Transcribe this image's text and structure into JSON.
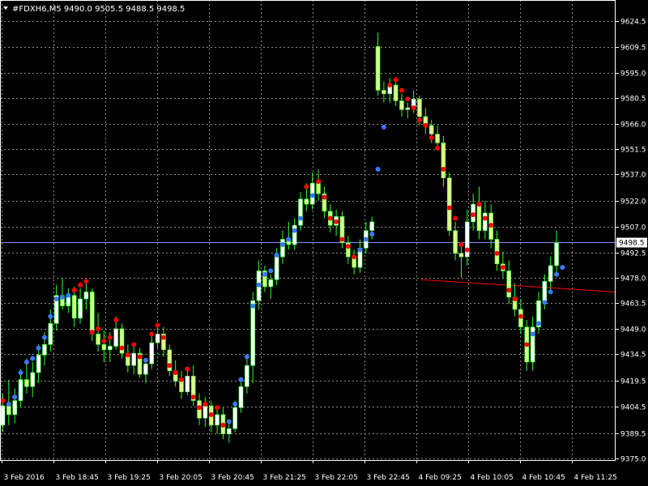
{
  "header": {
    "symbol_line": "#FDXH6,M5  9490.0 9505.5 9488.5 9498.5",
    "menu_icon": "triangle-down-icon"
  },
  "colors": {
    "background": "#000000",
    "grid": "#8c8c8c",
    "frame": "#ffffff",
    "axis_text": "#ffffff",
    "candle_wick": "#2aff2a",
    "bull_body": "#ffffff",
    "bear_body": "#d8ff8a",
    "dot_red": "#ff0000",
    "dot_blue": "#3c78ff",
    "trendline": "#ff0000",
    "bid_line": "#8a8aff",
    "price_tag_bg": "#ffffff"
  },
  "chart_data": {
    "type": "candlestick",
    "symbol": "#FDXH6",
    "timeframe": "M5",
    "current_price": 9498.5,
    "current_price_label": "9498.5",
    "ylim": [
      9375.0,
      9630.5
    ],
    "y_ticks": [
      "9624.5",
      "9609.5",
      "9595.0",
      "9580.5",
      "9566.0",
      "9551.5",
      "9537.0",
      "9522.0",
      "9507.0",
      "9492.5",
      "9478.0",
      "9463.5",
      "9449.0",
      "9434.5",
      "9419.5",
      "9404.5",
      "9389.5",
      "9375.0"
    ],
    "x_ticks": [
      "3 Feb 2016",
      "3 Feb 18:45",
      "3 Feb 19:25",
      "3 Feb 20:05",
      "3 Feb 20:45",
      "3 Feb 21:25",
      "3 Feb 22:05",
      "3 Feb 22:45",
      "4 Feb 09:25",
      "4 Feb 10:05",
      "4 Feb 10:45",
      "4 Feb 11:25"
    ],
    "grid": true,
    "trendline": {
      "from_bar": 70,
      "from_price": 9477.0,
      "to_bar": 118,
      "to_price": 9470.0
    },
    "candles": [
      [
        9394,
        9412,
        9390,
        9405
      ],
      [
        9405,
        9420,
        9394,
        9400
      ],
      [
        9400,
        9415,
        9395,
        9408
      ],
      [
        9408,
        9426,
        9404,
        9420
      ],
      [
        9420,
        9432,
        9412,
        9416
      ],
      [
        9416,
        9430,
        9410,
        9424
      ],
      [
        9424,
        9440,
        9418,
        9434
      ],
      [
        9434,
        9447,
        9428,
        9440
      ],
      [
        9440,
        9460,
        9436,
        9452
      ],
      [
        9452,
        9474,
        9448,
        9468
      ],
      [
        9468,
        9478,
        9460,
        9462
      ],
      [
        9462,
        9472,
        9458,
        9468
      ],
      [
        9468,
        9473,
        9450,
        9455
      ],
      [
        9455,
        9472,
        9452,
        9466
      ],
      [
        9466,
        9477,
        9460,
        9470
      ],
      [
        9470,
        9472,
        9442,
        9446
      ],
      [
        9446,
        9458,
        9436,
        9440
      ],
      [
        9440,
        9448,
        9430,
        9437
      ],
      [
        9437,
        9447,
        9430,
        9439
      ],
      [
        9439,
        9456,
        9437,
        9449
      ],
      [
        9449,
        9452,
        9432,
        9435
      ],
      [
        9435,
        9440,
        9424,
        9428
      ],
      [
        9428,
        9441,
        9423,
        9435
      ],
      [
        9435,
        9438,
        9421,
        9423
      ],
      [
        9423,
        9432,
        9418,
        9429
      ],
      [
        9429,
        9446,
        9426,
        9441
      ],
      [
        9441,
        9452,
        9438,
        9446
      ],
      [
        9446,
        9450,
        9433,
        9437
      ],
      [
        9437,
        9440,
        9422,
        9425
      ],
      [
        9425,
        9431,
        9416,
        9419
      ],
      [
        9419,
        9425,
        9409,
        9413
      ],
      [
        9413,
        9427,
        9411,
        9422
      ],
      [
        9422,
        9428,
        9405,
        9408
      ],
      [
        9408,
        9412,
        9394,
        9398
      ],
      [
        9398,
        9410,
        9393,
        9405
      ],
      [
        9405,
        9408,
        9390,
        9394
      ],
      [
        9394,
        9405,
        9389,
        9400
      ],
      [
        9400,
        9404,
        9386,
        9389
      ],
      [
        9389,
        9397,
        9384,
        9392
      ],
      [
        9392,
        9408,
        9390,
        9404
      ],
      [
        9404,
        9420,
        9401,
        9416
      ],
      [
        9416,
        9433,
        9412,
        9428
      ],
      [
        9428,
        9470,
        9418,
        9465
      ],
      [
        9465,
        9488,
        9460,
        9482
      ],
      [
        9482,
        9485,
        9470,
        9473
      ],
      [
        9473,
        9480,
        9466,
        9477
      ],
      [
        9477,
        9495,
        9474,
        9490
      ],
      [
        9490,
        9505,
        9486,
        9500
      ],
      [
        9500,
        9510,
        9494,
        9497
      ],
      [
        9497,
        9512,
        9494,
        9508
      ],
      [
        9508,
        9527,
        9505,
        9523
      ],
      [
        9523,
        9532,
        9516,
        9520
      ],
      [
        9520,
        9538,
        9517,
        9532
      ],
      [
        9532,
        9540,
        9522,
        9526
      ],
      [
        9526,
        9530,
        9512,
        9516
      ],
      [
        9516,
        9520,
        9504,
        9508
      ],
      [
        9508,
        9517,
        9502,
        9513
      ],
      [
        9513,
        9516,
        9495,
        9498
      ],
      [
        9498,
        9502,
        9486,
        9490
      ],
      [
        9490,
        9494,
        9480,
        9484
      ],
      [
        9484,
        9500,
        9481,
        9495
      ],
      [
        9495,
        9510,
        9492,
        9505
      ],
      [
        9505,
        9513,
        9500,
        9510
      ],
      [
        9610,
        9618,
        9582,
        9585
      ],
      [
        9585,
        9590,
        9578,
        9583
      ],
      [
        9583,
        9592,
        9578,
        9588
      ],
      [
        9588,
        9591,
        9576,
        9579
      ],
      [
        9579,
        9583,
        9570,
        9574
      ],
      [
        9574,
        9578,
        9569,
        9575
      ],
      [
        9575,
        9585,
        9572,
        9580
      ],
      [
        9580,
        9582,
        9565,
        9570
      ],
      [
        9570,
        9575,
        9560,
        9565
      ],
      [
        9565,
        9568,
        9555,
        9560
      ],
      [
        9560,
        9565,
        9552,
        9555
      ],
      [
        9555,
        9559,
        9530,
        9535
      ],
      [
        9535,
        9538,
        9502,
        9505
      ],
      [
        9505,
        9510,
        9488,
        9492
      ],
      [
        9492,
        9496,
        9478,
        9490
      ],
      [
        9490,
        9517,
        9485,
        9510
      ],
      [
        9510,
        9526,
        9505,
        9520
      ],
      [
        9520,
        9530,
        9500,
        9505
      ],
      [
        9505,
        9522,
        9500,
        9515
      ],
      [
        9515,
        9520,
        9495,
        9500
      ],
      [
        9500,
        9505,
        9482,
        9486
      ],
      [
        9486,
        9493,
        9478,
        9482
      ],
      [
        9482,
        9488,
        9463,
        9467
      ],
      [
        9467,
        9475,
        9456,
        9460
      ],
      [
        9460,
        9466,
        9446,
        9450
      ],
      [
        9450,
        9454,
        9425,
        9430
      ],
      [
        9430,
        9456,
        9425,
        9450
      ],
      [
        9450,
        9470,
        9446,
        9465
      ],
      [
        9465,
        9480,
        9460,
        9476
      ],
      [
        9476,
        9490,
        9470,
        9485
      ],
      [
        9485,
        9505,
        9481,
        9498
      ]
    ],
    "dots": [
      [
        "red",
        9408
      ],
      [
        "blue",
        9406
      ],
      [
        "blue",
        9410
      ],
      [
        "blue",
        9424
      ],
      [
        "blue",
        9430
      ],
      [
        "blue",
        9432
      ],
      [
        "blue",
        9438
      ],
      [
        "blue",
        9444
      ],
      [
        "blue",
        9456
      ],
      [
        "blue",
        9466
      ],
      [
        "blue",
        9467
      ],
      [
        "blue",
        9468
      ],
      [
        "red",
        9471
      ],
      [
        "red",
        9474
      ],
      [
        "red",
        9476
      ],
      [
        "red",
        9447
      ],
      [
        "red",
        9449
      ],
      [
        "red",
        9442
      ],
      [
        "red",
        9444
      ],
      [
        "red",
        9454
      ],
      [
        "red",
        9438
      ],
      [
        "red",
        9434
      ],
      [
        "red",
        9440
      ],
      [
        "red",
        9433
      ],
      [
        "blue",
        9431
      ],
      [
        "red",
        9446
      ],
      [
        "red",
        9451
      ],
      [
        "red",
        9444
      ],
      [
        "red",
        9428
      ],
      [
        "red",
        9424
      ],
      [
        "red",
        9420
      ],
      [
        "red",
        9426
      ],
      [
        "red",
        9410
      ],
      [
        "red",
        9404
      ],
      [
        "red",
        9406
      ],
      [
        "red",
        9400
      ],
      [
        "red",
        9404
      ],
      [
        "red",
        9394
      ],
      [
        "blue",
        9396
      ],
      [
        "blue",
        9406
      ],
      [
        "blue",
        9420
      ],
      [
        "blue",
        9433
      ],
      [
        "blue",
        9462
      ],
      [
        "blue",
        9474
      ],
      [
        "blue",
        9480
      ],
      [
        "blue",
        9482
      ],
      [
        "blue",
        9491
      ],
      [
        "blue",
        9497
      ],
      [
        "blue",
        9500
      ],
      [
        "blue",
        9505
      ],
      [
        "blue",
        9512
      ],
      [
        "red",
        9530
      ],
      [
        "blue",
        9525
      ],
      [
        "red",
        9533
      ],
      [
        "red",
        9524
      ],
      [
        "red",
        9512
      ],
      [
        "red",
        9510
      ],
      [
        "red",
        9500
      ],
      [
        "red",
        9496
      ],
      [
        "red",
        9490
      ],
      [
        "blue",
        9494
      ],
      [
        "blue",
        9500
      ],
      [
        "blue",
        9503
      ],
      [
        "blue",
        9540
      ],
      [
        "blue",
        9564
      ],
      [
        "red",
        9588
      ],
      [
        "red",
        9591
      ],
      [
        "red",
        9585
      ],
      [
        "red",
        9580
      ],
      [
        "red",
        9575
      ],
      [
        "red",
        9568
      ],
      [
        "red",
        9565
      ],
      [
        "red",
        9558
      ],
      [
        "red",
        9552
      ],
      [
        "red",
        9540
      ],
      [
        "red",
        9518
      ],
      [
        "red",
        9512
      ],
      [
        "red",
        9497
      ],
      [
        "red",
        9494
      ],
      [
        "red",
        9514
      ],
      [
        "red",
        9520
      ],
      [
        "red",
        9512
      ],
      [
        "red",
        9508
      ],
      [
        "red",
        9492
      ],
      [
        "red",
        9484
      ],
      [
        "red",
        9471
      ],
      [
        "red",
        9466
      ],
      [
        "red",
        9456
      ],
      [
        "red",
        9440
      ],
      [
        "blue",
        9446
      ],
      [
        "blue",
        9452
      ],
      [
        "blue",
        9464
      ],
      [
        "blue",
        9470
      ],
      [
        "blue",
        9480
      ],
      [
        "blue",
        9484
      ]
    ]
  }
}
